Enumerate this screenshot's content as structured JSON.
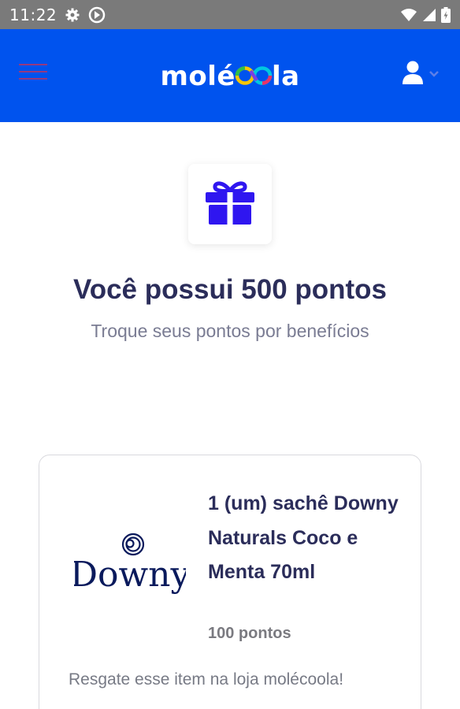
{
  "status_bar": {
    "time": "11:22",
    "icons": [
      "gear-icon",
      "media-icon",
      "wifi-icon",
      "signal-icon",
      "battery-icon"
    ]
  },
  "app_bar": {
    "background_color": "#0053ee",
    "logo_text_start": "molé",
    "logo_text_end": "la",
    "logo_icon": "infinity-loop-icon",
    "menu_icon": "hamburger-menu-icon",
    "user_icon": "user-icon",
    "dropdown_icon": "chevron-down-icon"
  },
  "header": {
    "icon": "gift-icon",
    "title": "Você possui 500 pontos",
    "subtitle": "Troque seus pontos por benefícios"
  },
  "rewards": [
    {
      "brand_logo_text": "Downy",
      "name": "1 (um) sachê Downy Naturals Coco e Menta 70ml",
      "points": "100 pontos",
      "hint": "Resgate esse item na loja molécoola!"
    }
  ],
  "colors": {
    "primary": "#0053ee",
    "gift": "#2f16f0",
    "title": "#2b2d5a",
    "brand_navy": "#0a1a5c"
  }
}
